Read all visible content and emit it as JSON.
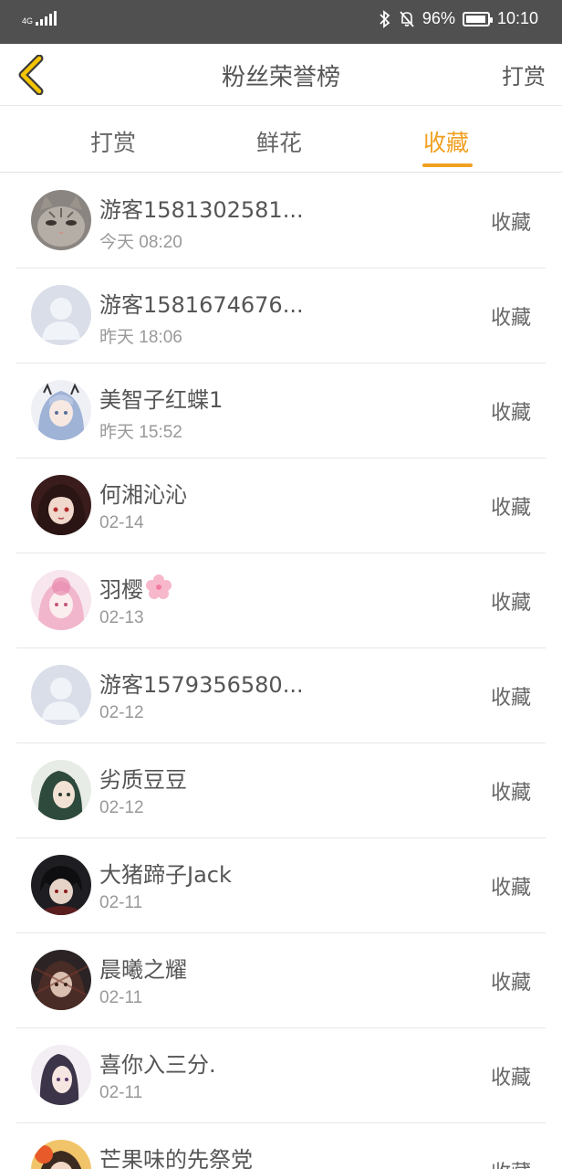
{
  "status": {
    "network": "4G",
    "battery": "96%",
    "battery_level": 0.96,
    "time": "10:10"
  },
  "header": {
    "title": "粉丝荣誉榜",
    "action": "打赏"
  },
  "tabs": [
    {
      "label": "打赏",
      "active": false
    },
    {
      "label": "鲜花",
      "active": false
    },
    {
      "label": "收藏",
      "active": true
    }
  ],
  "colors": {
    "accent": "#f0a020",
    "status_bar": "#505050",
    "text": "#555555",
    "subtext": "#999999"
  },
  "fans": [
    {
      "name": "游客1581302581...",
      "time": "今天 08:20",
      "action": "收藏",
      "avatar": "cat-photo"
    },
    {
      "name": "游客1581674676...",
      "time": "昨天 18:06",
      "action": "收藏",
      "avatar": "default-user"
    },
    {
      "name": "美智子红蝶1",
      "time": "昨天 15:52",
      "action": "收藏",
      "avatar": "anime-girl-blue"
    },
    {
      "name": "何湘沁沁",
      "time": "02-14",
      "action": "收藏",
      "avatar": "anime-girl-red"
    },
    {
      "name": "羽樱",
      "time": "02-13",
      "action": "收藏",
      "avatar": "anime-girl-pink",
      "emoji": "cherry-blossom-icon"
    },
    {
      "name": "游客1579356580...",
      "time": "02-12",
      "action": "收藏",
      "avatar": "default-user"
    },
    {
      "name": "劣质豆豆",
      "time": "02-12",
      "action": "收藏",
      "avatar": "anime-girl-green"
    },
    {
      "name": "大猪蹄子Jack",
      "time": "02-11",
      "action": "收藏",
      "avatar": "anime-boy-dark"
    },
    {
      "name": "晨曦之耀",
      "time": "02-11",
      "action": "收藏",
      "avatar": "anime-dark"
    },
    {
      "name": "喜你入三分.",
      "time": "02-11",
      "action": "收藏",
      "avatar": "anime-girl-purple"
    },
    {
      "name": "芒果味的先祭党",
      "time": "",
      "action": "收藏",
      "avatar": "anime-orange"
    }
  ]
}
